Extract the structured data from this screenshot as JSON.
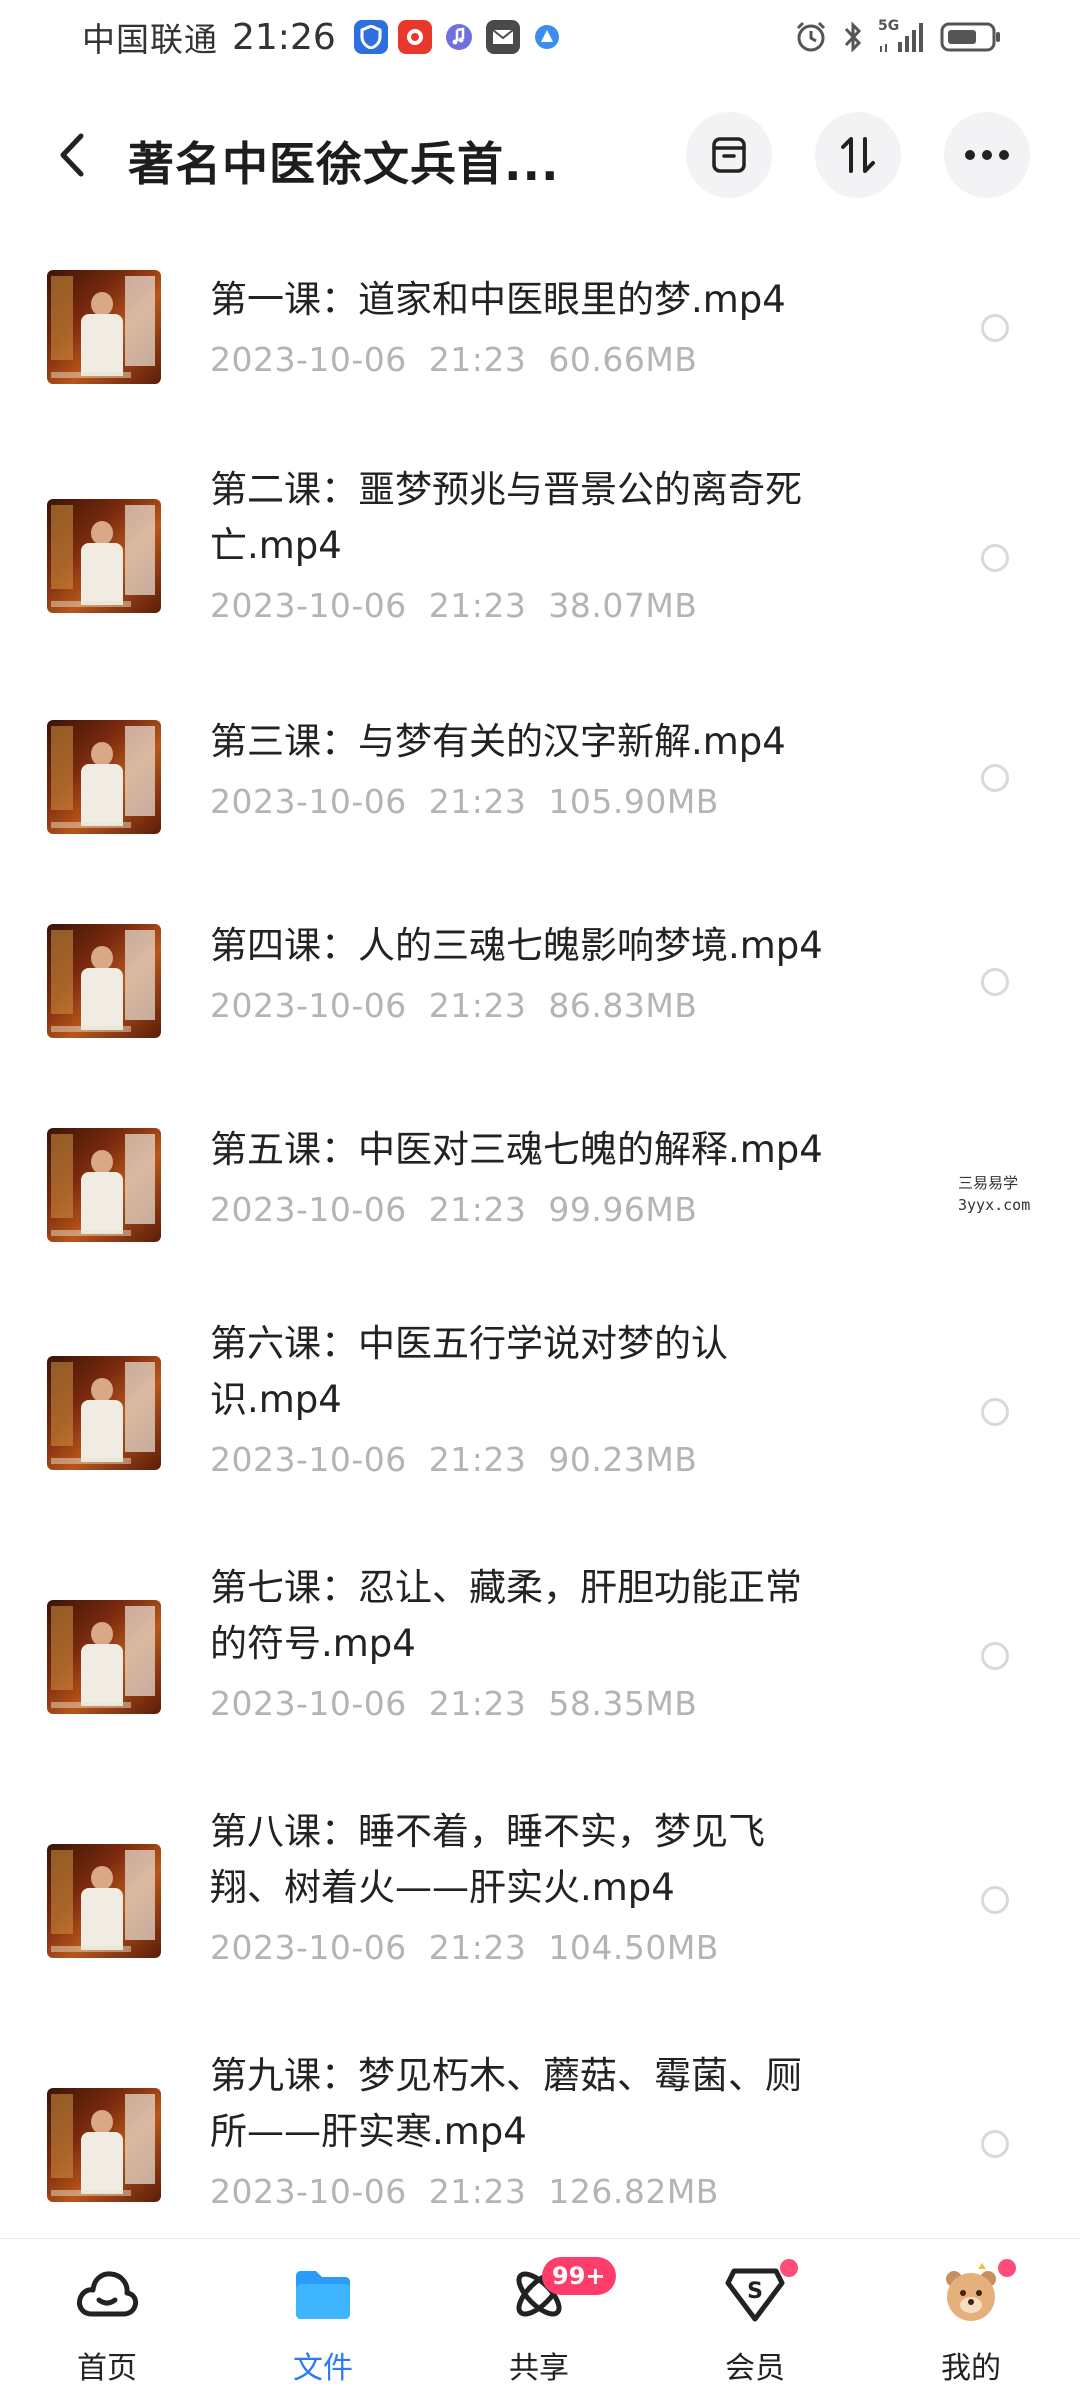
{
  "status_bar": {
    "carrier": "中国联通",
    "time": "21:26",
    "network": "5G",
    "icons": [
      "app-shield-icon",
      "app-red-icon",
      "music-icon",
      "mail-icon",
      "browser-icon",
      "alarm-icon",
      "bluetooth-icon",
      "signal-icon",
      "battery-icon"
    ]
  },
  "header": {
    "title": "著名中医徐文兵首...",
    "icons": [
      "back-icon",
      "archive-icon",
      "sort-icon",
      "more-icon"
    ]
  },
  "files": [
    {
      "name": "第一课：道家和中医眼里的梦.mp4",
      "date": "2023-10-06",
      "time": "21:23",
      "size": "60.66MB"
    },
    {
      "name": "第二课：噩梦预兆与晋景公的离奇死亡.mp4",
      "name_line1": "第二课：噩梦预兆与晋景公的离奇死",
      "name_line2": "亡.mp4",
      "date": "2023-10-06",
      "time": "21:23",
      "size": "38.07MB"
    },
    {
      "name": "第三课：与梦有关的汉字新解.mp4",
      "date": "2023-10-06",
      "time": "21:23",
      "size": "105.90MB"
    },
    {
      "name": "第四课：人的三魂七魄影响梦境.mp4",
      "date": "2023-10-06",
      "time": "21:23",
      "size": "86.83MB"
    },
    {
      "name": "第五课：中医对三魂七魄的解释.mp4",
      "date": "2023-10-06",
      "time": "21:23",
      "size": "99.96MB"
    },
    {
      "name": "第六课：中医五行学说对梦的认识.mp4",
      "name_line1": "第六课：中医五行学说对梦的认",
      "name_line2": "识.mp4",
      "date": "2023-10-06",
      "time": "21:23",
      "size": "90.23MB"
    },
    {
      "name": "第七课：忍让、藏柔，肝胆功能正常的符号.mp4",
      "name_line1": "第七课：忍让、藏柔，肝胆功能正常",
      "name_line2": "的符号.mp4",
      "date": "2023-10-06",
      "time": "21:23",
      "size": "58.35MB"
    },
    {
      "name": "第八课：睡不着，睡不实，梦见飞翔、树着火——肝实火.mp4",
      "name_line1": "第八课：睡不着，睡不实，梦见飞",
      "name_line2": "翔、树着火——肝实火.mp4",
      "date": "2023-10-06",
      "time": "21:23",
      "size": "104.50MB"
    },
    {
      "name": "第九课：梦见朽木、蘑菇、霉菌、厕所——肝实寒.mp4",
      "name_line1": "第九课：梦见朽木、蘑菇、霉菌、厕",
      "name_line2": "所——肝实寒.mp4",
      "date": "2023-10-06",
      "time": "21:23",
      "size": "126.82MB"
    }
  ],
  "watermark": {
    "line1": "三易易学",
    "line2": "3yyx.com"
  },
  "tab_bar": {
    "tabs": [
      {
        "label": "首页",
        "icon": "cloud-home-icon",
        "active": false
      },
      {
        "label": "文件",
        "icon": "folder-icon",
        "active": true
      },
      {
        "label": "共享",
        "icon": "atom-share-icon",
        "active": false,
        "badge": "99+"
      },
      {
        "label": "会员",
        "icon": "vip-diamond-icon",
        "active": false
      },
      {
        "label": "我的",
        "icon": "bear-avatar-icon",
        "active": false
      }
    ]
  },
  "colors": {
    "accent": "#2a7bf6",
    "badge": "#ff3d6a",
    "meta_text": "#b4b4b8",
    "title_text": "#1d1d1d"
  }
}
